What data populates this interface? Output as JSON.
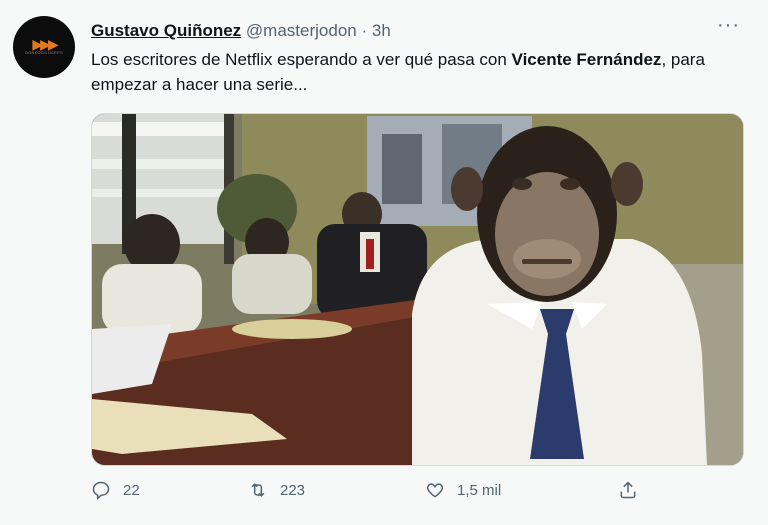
{
  "tweet": {
    "author_name": "Gustavo Quiñonez",
    "author_handle": "@masterjodon",
    "separator": "·",
    "time": "3h",
    "more_label": "···",
    "text_part1": "Los escritores de Netflix esperando a ver qué pasa con ",
    "text_bold1": "Vicente Fernández",
    "text_part2": ", para empezar a hacer una serie...",
    "avatar_logo_text": "DONKOOS DEEPS"
  },
  "actions": {
    "replies": "22",
    "retweets": "223",
    "likes": "1,5 mil"
  },
  "icons": {
    "reply": "reply-icon",
    "retweet": "retweet-icon",
    "like": "heart-icon",
    "share": "share-icon",
    "more": "more-icon"
  },
  "colors": {
    "text": "#0f1419",
    "secondary": "#536471",
    "background": "#f7f9f9"
  }
}
